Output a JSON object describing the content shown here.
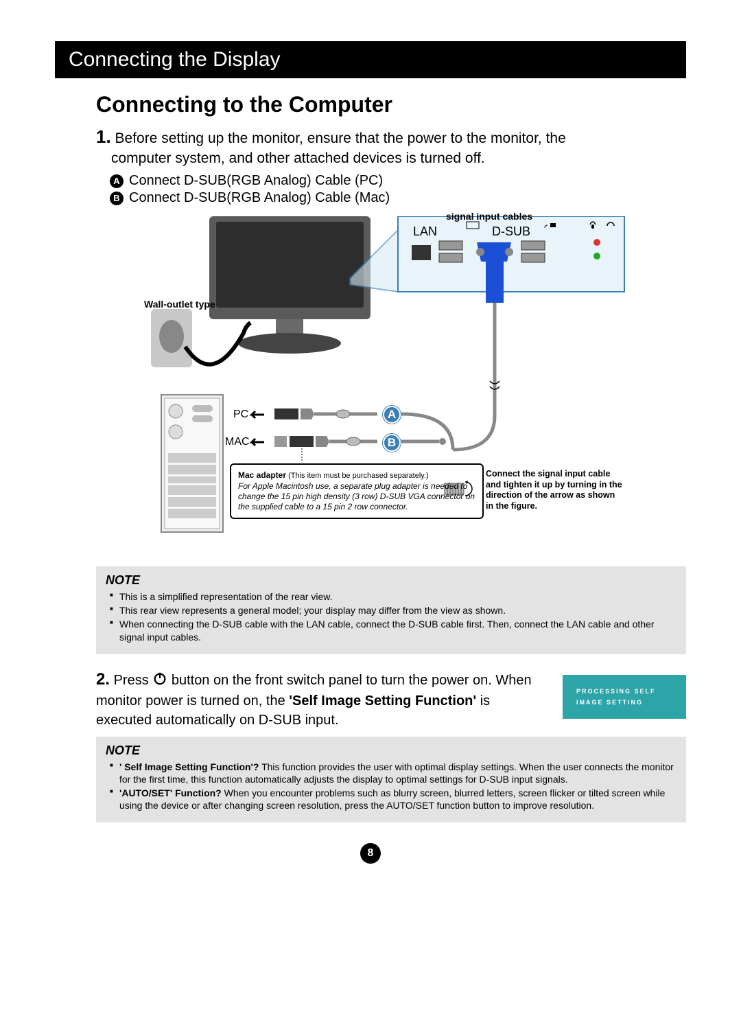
{
  "header": "Connecting the Display",
  "main_title": "Connecting to the Computer",
  "step1": {
    "num": "1.",
    "text_a": "Before setting up the monitor, ensure that the power to the monitor, the",
    "text_b": "computer system, and other attached devices is turned off."
  },
  "sub_a": {
    "badge": "A",
    "text": "Connect D-SUB(RGB Analog) Cable (PC)"
  },
  "sub_b": {
    "badge": "B",
    "text": "Connect D-SUB(RGB Analog) Cable (Mac)"
  },
  "diagram": {
    "wall_label": "Wall-outlet type",
    "sig_label": "signal input cables",
    "port_lan": "LAN",
    "port_dsub": "D-SUB",
    "pc": "PC",
    "mac": "MAC",
    "cable_a": "A",
    "cable_b": "B",
    "mac_adapter_title": "Mac adapter",
    "mac_adapter_paren": " (This item must be purchased separately.)",
    "mac_adapter_body": "For Apple Macintosh use, a  separate plug adapter is needed to change the 15 pin high density (3 row) D-SUB VGA connector on the supplied cable to a 15 pin  2 row connector.",
    "tighten": "Connect the signal input cable and tighten it up by turning in the direction of the arrow as shown in the figure."
  },
  "note1": {
    "title": "NOTE",
    "items": [
      "This is a simplified representation of the rear view.",
      "This rear view represents a general model; your display may differ from the view as shown.",
      "When connecting the D-SUB cable with the LAN cable, connect the D-SUB cable first. Then, connect the LAN cable and other signal input cables."
    ]
  },
  "step2": {
    "num": "2.",
    "t1": "Press",
    "t2": "button on the front switch panel to turn the power on. When monitor power is turned on, the",
    "bold": "'Self Image Setting Function'",
    "t3": "is executed automatically on D-SUB input."
  },
  "osd": {
    "l1": "PROCESSING SELF",
    "l2": "IMAGE SETTING"
  },
  "note2": {
    "title": "NOTE",
    "items": [
      {
        "b": "' Self Image Setting Function'?",
        "t": " This function provides the user with optimal display settings. When the user connects the monitor for the first time, this function automatically adjusts the display to optimal settings for D-SUB input signals."
      },
      {
        "b": "'AUTO/SET' Function?",
        "t": " When you encounter problems such as blurry screen, blurred letters, screen flicker or tilted screen while using the device or after changing screen resolution, press the AUTO/SET function button to improve resolution."
      }
    ]
  },
  "page_number": "8"
}
